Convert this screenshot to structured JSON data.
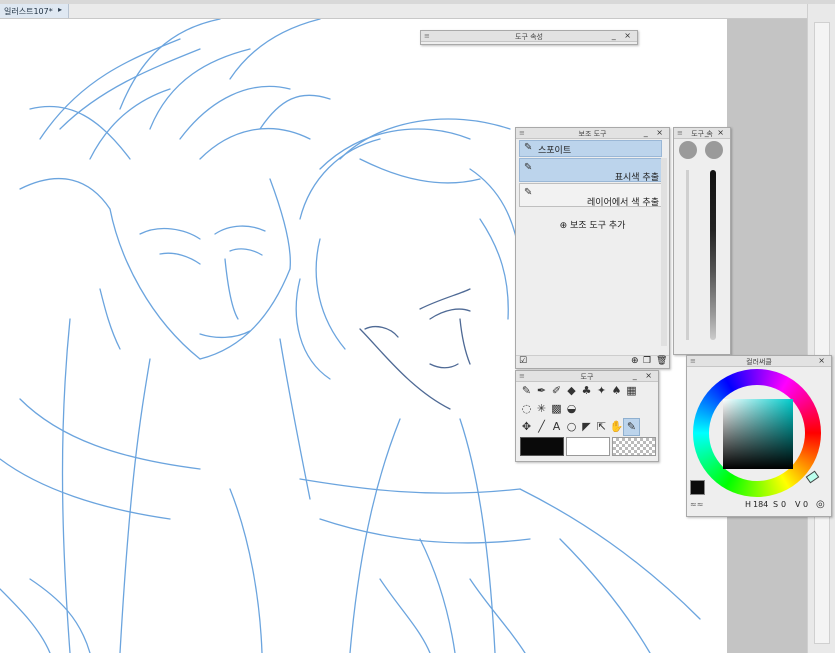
{
  "document": {
    "tab_label": "일러스트107*",
    "tab_arrow": "▸"
  },
  "panels": {
    "tool_property": {
      "title": "도구 속성",
      "controls": "_ ×"
    },
    "sub_tool": {
      "title": "보조 도구",
      "controls": "_ ×",
      "group_name": "스포이트",
      "items": [
        {
          "label": "표시색 추출",
          "selected": true
        },
        {
          "label": "레이어에서 색 추출",
          "selected": false
        }
      ],
      "add_label": "보조 도구 추가"
    },
    "brush_size": {
      "title": "도구 속",
      "controls": "_ ×"
    },
    "tool": {
      "title": "도구",
      "controls": "_ ×",
      "icons": [
        "pencil-icon",
        "pen-icon",
        "brush-icon",
        "fill-icon",
        "blend-icon",
        "sparkle-icon",
        "blur-icon",
        "frame-icon",
        "lasso-icon",
        "magic-wand-icon",
        "gradient-icon",
        "bucket-icon",
        "move-icon",
        "line-icon",
        "text-icon",
        "speech-bubble-icon",
        "ruler-icon",
        "select-object-icon",
        "hand-icon",
        "eyedropper-icon"
      ]
    },
    "color_wheel": {
      "title": "컬러써클",
      "controls": "×",
      "values": {
        "h": "184",
        "s": "0",
        "v": "0"
      }
    }
  },
  "colors": {
    "accent_selected": "#bcd4ec",
    "panel_bg": "#eeeeee",
    "sketch_stroke": "#5b9bdb",
    "main_color": "#0a0a0a"
  }
}
